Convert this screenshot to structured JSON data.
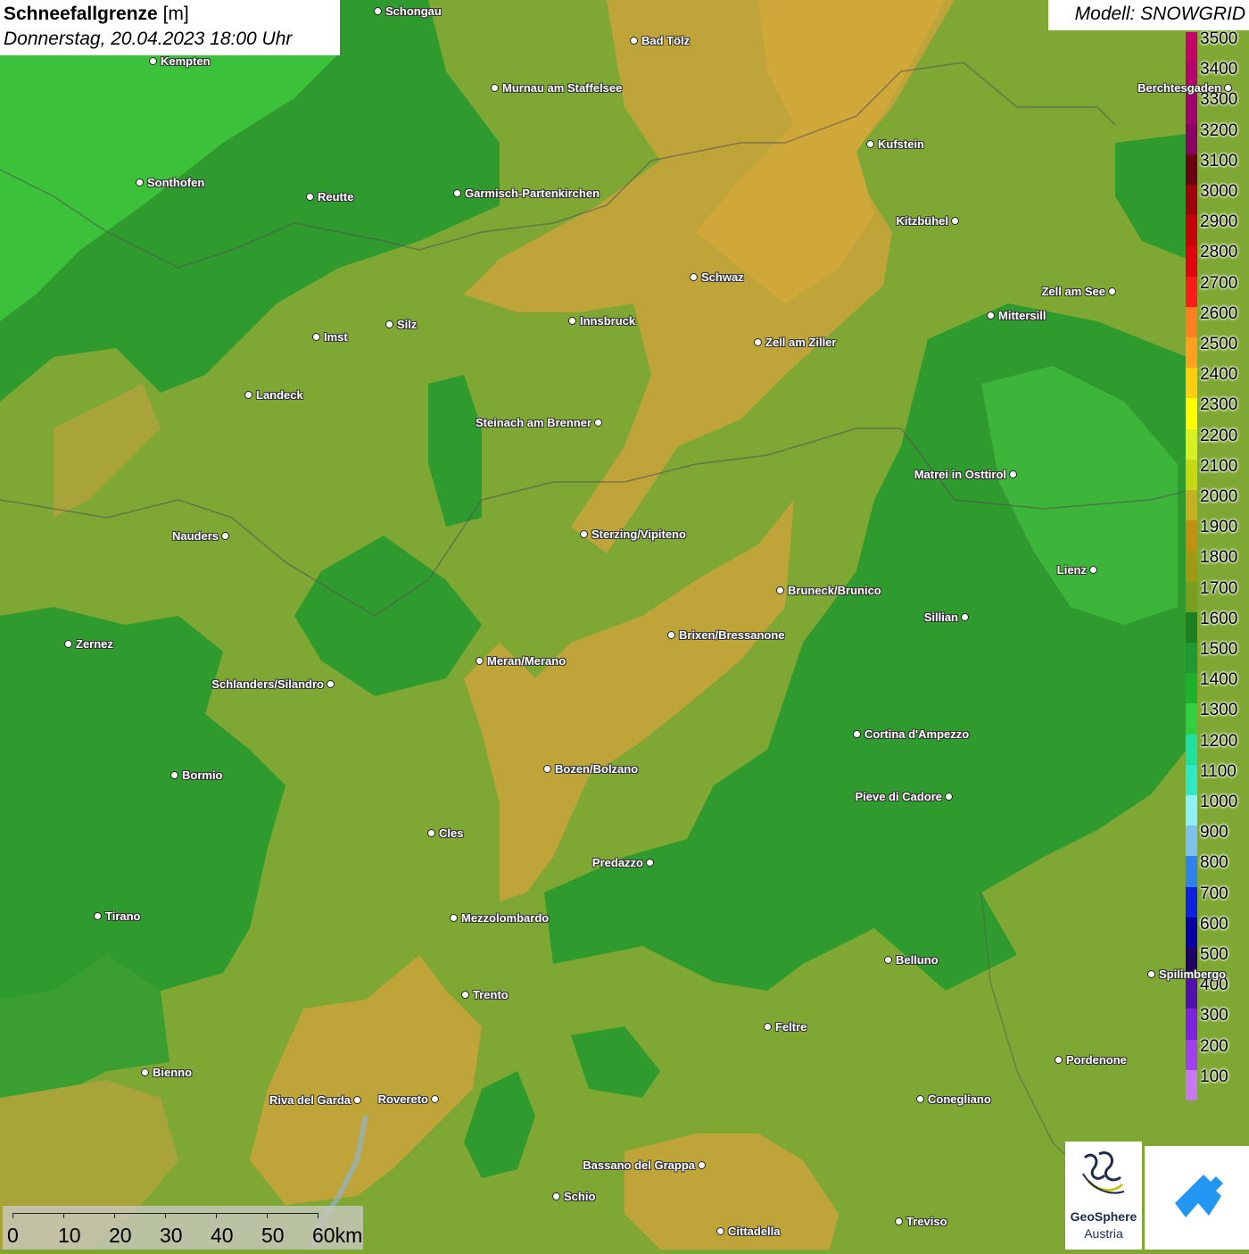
{
  "header": {
    "title_bold": "Schneefallgrenze",
    "title_unit": "[m]",
    "datetime": "Donnerstag, 20.04.2023 18:00 Uhr",
    "model": "Modell: SNOWGRID"
  },
  "legend": {
    "steps": [
      {
        "label": "3500",
        "color": "#c4006a"
      },
      {
        "label": "3400",
        "color": "#b5006d"
      },
      {
        "label": "3300",
        "color": "#a00070"
      },
      {
        "label": "3200",
        "color": "#8a0066"
      },
      {
        "label": "3100",
        "color": "#6a0010"
      },
      {
        "label": "3000",
        "color": "#a0000a"
      },
      {
        "label": "2900",
        "color": "#c8000a"
      },
      {
        "label": "2800",
        "color": "#e00010"
      },
      {
        "label": "2700",
        "color": "#ff1a1a"
      },
      {
        "label": "2600",
        "color": "#ff7f20"
      },
      {
        "label": "2500",
        "color": "#ffa020"
      },
      {
        "label": "2400",
        "color": "#ffcc10"
      },
      {
        "label": "2300",
        "color": "#ffff00"
      },
      {
        "label": "2200",
        "color": "#d8f020"
      },
      {
        "label": "2100",
        "color": "#c8d810"
      },
      {
        "label": "2000",
        "color": "#c4b020"
      },
      {
        "label": "1900",
        "color": "#c09010"
      },
      {
        "label": "1800",
        "color": "#a09a10"
      },
      {
        "label": "1700",
        "color": "#7a9e20"
      },
      {
        "label": "1600",
        "color": "#1a8020"
      },
      {
        "label": "1500",
        "color": "#209a30"
      },
      {
        "label": "1400",
        "color": "#20b030"
      },
      {
        "label": "1300",
        "color": "#30d040"
      },
      {
        "label": "1200",
        "color": "#20e0a0"
      },
      {
        "label": "1100",
        "color": "#30e8c8"
      },
      {
        "label": "1000",
        "color": "#90f0f8"
      },
      {
        "label": "900",
        "color": "#80c0f0"
      },
      {
        "label": "800",
        "color": "#3080f0"
      },
      {
        "label": "700",
        "color": "#1020e0"
      },
      {
        "label": "600",
        "color": "#0800a0"
      },
      {
        "label": "500",
        "color": "#200060"
      },
      {
        "label": "400",
        "color": "#5010b0"
      },
      {
        "label": "300",
        "color": "#8020e0"
      },
      {
        "label": "200",
        "color": "#a040f0"
      },
      {
        "label": "100",
        "color": "#c878f0"
      }
    ]
  },
  "cities": [
    {
      "name": "Schongau"
    },
    {
      "name": "Kempten"
    },
    {
      "name": "Bad Tölz"
    },
    {
      "name": "Murnau am Staffelsee"
    },
    {
      "name": "Kufstein"
    },
    {
      "name": "Berchtesgaden"
    },
    {
      "name": "Sonthofen"
    },
    {
      "name": "Reutte"
    },
    {
      "name": "Garmisch-Partenkirchen"
    },
    {
      "name": "Kitzbühel"
    },
    {
      "name": "Schwaz"
    },
    {
      "name": "Zell am See"
    },
    {
      "name": "Innsbruck"
    },
    {
      "name": "Mittersill"
    },
    {
      "name": "Imst"
    },
    {
      "name": "Silz"
    },
    {
      "name": "Zell am Ziller"
    },
    {
      "name": "Landeck"
    },
    {
      "name": "Steinach am Brenner"
    },
    {
      "name": "Matrei in Osttirol"
    },
    {
      "name": "Nauders"
    },
    {
      "name": "Sterzing/Vipiteno"
    },
    {
      "name": "Lienz"
    },
    {
      "name": "Bruneck/Brunico"
    },
    {
      "name": "Sillian"
    },
    {
      "name": "Brixen/Bressanone"
    },
    {
      "name": "Zernez"
    },
    {
      "name": "Meran/Merano"
    },
    {
      "name": "Schlanders/Silandro"
    },
    {
      "name": "Cortina d'Ampezzo"
    },
    {
      "name": "Bozen/Bolzano"
    },
    {
      "name": "Bormio"
    },
    {
      "name": "Pieve di Cadore"
    },
    {
      "name": "Cles"
    },
    {
      "name": "Predazzo"
    },
    {
      "name": "Tirano"
    },
    {
      "name": "Mezzolombardo"
    },
    {
      "name": "Belluno"
    },
    {
      "name": "Spilimbergo"
    },
    {
      "name": "Trento"
    },
    {
      "name": "Feltre"
    },
    {
      "name": "Pordenone"
    },
    {
      "name": "Bienno"
    },
    {
      "name": "Riva del Garda"
    },
    {
      "name": "Rovereto"
    },
    {
      "name": "Conegliano"
    },
    {
      "name": "Bassano del Grappa"
    },
    {
      "name": "Schio"
    },
    {
      "name": "Treviso"
    },
    {
      "name": "Cittadella"
    }
  ],
  "scale": {
    "ticks": [
      "0",
      "10",
      "20",
      "30",
      "40",
      "50",
      "60km"
    ]
  },
  "logos": {
    "org_name": "GeoSphere",
    "org_sub": "Austria"
  },
  "colors": {
    "base": "#7ea833",
    "low": "#2f9a2e",
    "lowest": "#3cc13a",
    "high": "#b8a535"
  }
}
